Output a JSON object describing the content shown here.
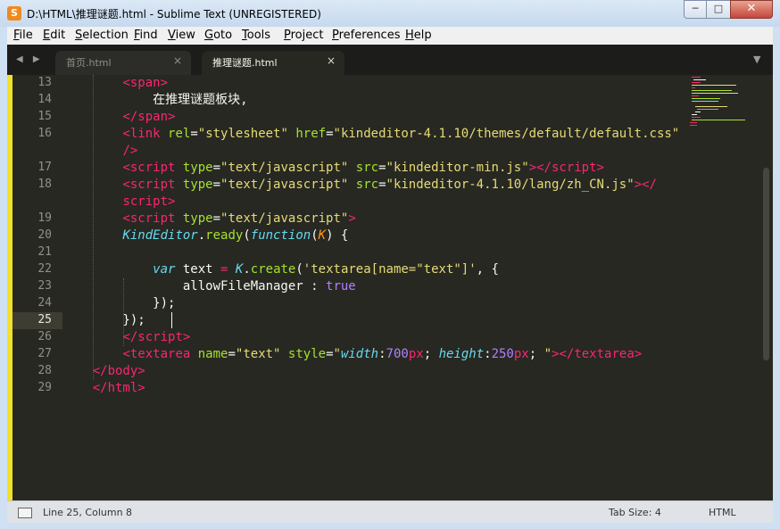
{
  "window": {
    "title": "D:\\HTML\\推理谜题.html - Sublime Text (UNREGISTERED)",
    "app_icon_label": "S",
    "controls": {
      "minimize": "─",
      "maximize": "□",
      "close": "✕"
    }
  },
  "menu": [
    "File",
    "Edit",
    "Selection",
    "Find",
    "View",
    "Goto",
    "Tools",
    "Project",
    "Preferences",
    "Help"
  ],
  "tabs": [
    {
      "label": "首页.html",
      "close": "×"
    },
    {
      "label": "推理谜题.html",
      "close": "×"
    }
  ],
  "tab_nav": {
    "arrows": "◀ ▶",
    "dropdown": "▼"
  },
  "gutter": {
    "line_numbers": [
      "13",
      "14",
      "15",
      "16",
      "",
      "17",
      "18",
      "",
      "19",
      "20",
      "21",
      "22",
      "23",
      "24",
      "25",
      "26",
      "27",
      "28",
      "29"
    ],
    "current_line": "25"
  },
  "code_lines": [
    [
      [
        "p",
        "        "
      ],
      [
        "t",
        "<"
      ],
      [
        "g",
        "span"
      ],
      [
        "t",
        ">"
      ]
    ],
    [
      [
        "p",
        "            在推理谜题板块,"
      ]
    ],
    [
      [
        "p",
        "        "
      ],
      [
        "t",
        "</"
      ],
      [
        "g",
        "span"
      ],
      [
        "t",
        ">"
      ]
    ],
    [
      [
        "p",
        "        "
      ],
      [
        "t",
        "<"
      ],
      [
        "g",
        "link"
      ],
      [
        "p",
        " "
      ],
      [
        "a",
        "rel"
      ],
      [
        "p",
        "="
      ],
      [
        "s",
        "\"stylesheet\""
      ],
      [
        "p",
        " "
      ],
      [
        "a",
        "href"
      ],
      [
        "p",
        "="
      ],
      [
        "s",
        "\"kindeditor-4.1.10/themes/default/default.css\""
      ]
    ],
    [
      [
        "p",
        "        "
      ],
      [
        "t",
        "/>"
      ]
    ],
    [
      [
        "p",
        "        "
      ],
      [
        "t",
        "<"
      ],
      [
        "g",
        "script"
      ],
      [
        "p",
        " "
      ],
      [
        "a",
        "type"
      ],
      [
        "p",
        "="
      ],
      [
        "s",
        "\"text/javascript\""
      ],
      [
        "p",
        " "
      ],
      [
        "a",
        "src"
      ],
      [
        "p",
        "="
      ],
      [
        "s",
        "\"kindeditor-min.js\""
      ],
      [
        "t",
        "></"
      ],
      [
        "g",
        "script"
      ],
      [
        "t",
        ">"
      ]
    ],
    [
      [
        "p",
        "        "
      ],
      [
        "t",
        "<"
      ],
      [
        "g",
        "script"
      ],
      [
        "p",
        " "
      ],
      [
        "a",
        "type"
      ],
      [
        "p",
        "="
      ],
      [
        "s",
        "\"text/javascript\""
      ],
      [
        "p",
        " "
      ],
      [
        "a",
        "src"
      ],
      [
        "p",
        "="
      ],
      [
        "s",
        "\"kindeditor-4.1.10/lang/zh_CN.js\""
      ],
      [
        "t",
        "></"
      ]
    ],
    [
      [
        "p",
        "        "
      ],
      [
        "g",
        "script"
      ],
      [
        "t",
        ">"
      ]
    ],
    [
      [
        "p",
        "        "
      ],
      [
        "t",
        "<"
      ],
      [
        "g",
        "script"
      ],
      [
        "p",
        " "
      ],
      [
        "a",
        "type"
      ],
      [
        "p",
        "="
      ],
      [
        "s",
        "\"text/javascript\""
      ],
      [
        "t",
        ">"
      ]
    ],
    [
      [
        "p",
        "        "
      ],
      [
        "i",
        "KindEditor"
      ],
      [
        "p",
        "."
      ],
      [
        "a",
        "ready"
      ],
      [
        "p",
        "("
      ],
      [
        "i",
        "function"
      ],
      [
        "p",
        "("
      ],
      [
        "o",
        "K"
      ],
      [
        "p",
        ") {"
      ]
    ],
    [
      [
        "p",
        ""
      ]
    ],
    [
      [
        "p",
        "            "
      ],
      [
        "i",
        "var"
      ],
      [
        "p",
        " text "
      ],
      [
        "g",
        "="
      ],
      [
        "p",
        " "
      ],
      [
        "i",
        "K"
      ],
      [
        "p",
        "."
      ],
      [
        "a",
        "create"
      ],
      [
        "p",
        "("
      ],
      [
        "s",
        "'textarea[name=\"text\"]'"
      ],
      [
        "p",
        ", {"
      ]
    ],
    [
      [
        "p",
        "                allowFileManager : "
      ],
      [
        "n",
        "true"
      ]
    ],
    [
      [
        "p",
        "            });"
      ]
    ],
    [
      [
        "p",
        "        });"
      ]
    ],
    [
      [
        "p",
        "        "
      ],
      [
        "t",
        "</"
      ],
      [
        "g",
        "script"
      ],
      [
        "t",
        ">"
      ]
    ],
    [
      [
        "p",
        "        "
      ],
      [
        "t",
        "<"
      ],
      [
        "g",
        "textarea"
      ],
      [
        "p",
        " "
      ],
      [
        "a",
        "name"
      ],
      [
        "p",
        "="
      ],
      [
        "s",
        "\"text\""
      ],
      [
        "p",
        " "
      ],
      [
        "a",
        "style"
      ],
      [
        "p",
        "="
      ],
      [
        "s",
        "\""
      ],
      [
        "i",
        "width"
      ],
      [
        "p",
        ":"
      ],
      [
        "n",
        "700"
      ],
      [
        "g",
        "px"
      ],
      [
        "p",
        "; "
      ],
      [
        "i",
        "height"
      ],
      [
        "p",
        ":"
      ],
      [
        "n",
        "250"
      ],
      [
        "g",
        "px"
      ],
      [
        "p",
        "; "
      ],
      [
        "s",
        "\""
      ],
      [
        "t",
        "></"
      ],
      [
        "g",
        "textarea"
      ],
      [
        "t",
        ">"
      ]
    ],
    [
      [
        "p",
        "    "
      ],
      [
        "t",
        "</"
      ],
      [
        "g",
        "body"
      ],
      [
        "t",
        ">"
      ]
    ],
    [
      [
        "p",
        "    "
      ],
      [
        "t",
        "</"
      ],
      [
        "g",
        "html"
      ],
      [
        "t",
        ">"
      ]
    ]
  ],
  "status": {
    "position": "Line 25, Column 8",
    "tab_size": "Tab Size: 4",
    "syntax": "HTML"
  },
  "colors": {
    "background": "#272822",
    "foreground": "#f8f8f2",
    "tag": "#f92672",
    "attribute": "#a6e22e",
    "string": "#e6db74",
    "keyword": "#66d9ef",
    "parameter": "#fd971f",
    "number": "#ae81ff",
    "line_highlight": "#3e3d32"
  }
}
